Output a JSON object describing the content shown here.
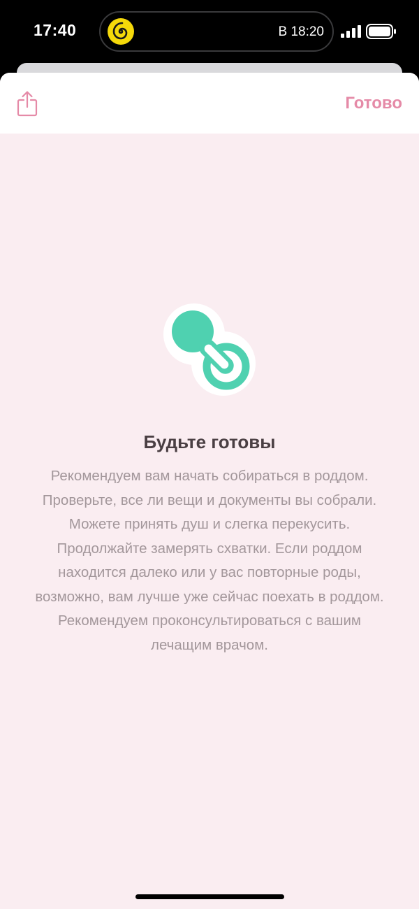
{
  "status_bar": {
    "time": "17:40",
    "live_activity_text": "В 18:20",
    "app_icon": "spiral-icon",
    "colors": {
      "app_icon": "#f5d90a"
    }
  },
  "header": {
    "share_icon": "share-icon",
    "done_label": "Готово",
    "colors": {
      "accent": "#e58aa7"
    }
  },
  "content": {
    "icon": "pacifier-icon",
    "title": "Будьте готовы",
    "description": "Рекомендуем вам начать собираться в роддом. Проверьте, все ли вещи и документы вы собрали. Можете принять душ и слегка перекусить. Продолжайте замерять схватки. Если роддом находится далеко или у вас повторные роды, возможно, вам лучше уже сейчас поехать в роддом. Рекомендуем проконсультироваться с вашим лечащим врачом.",
    "colors": {
      "background": "#faedf1",
      "icon": "#4fd1b0",
      "title": "#4a3f43",
      "text": "#a3979b"
    }
  }
}
